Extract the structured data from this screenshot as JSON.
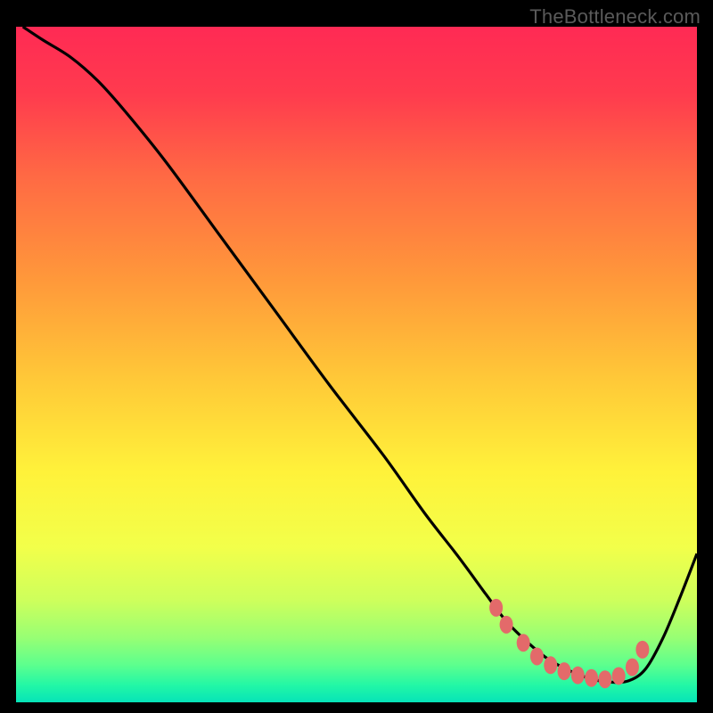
{
  "watermark": "TheBottleneck.com",
  "chart_data": {
    "type": "line",
    "title": "",
    "xlabel": "",
    "ylabel": "",
    "xlim": [
      0,
      100
    ],
    "ylim": [
      0,
      100
    ],
    "gradient_stops": [
      {
        "offset": 0.0,
        "color": "#ff2a54"
      },
      {
        "offset": 0.1,
        "color": "#ff3b4e"
      },
      {
        "offset": 0.22,
        "color": "#ff6944"
      },
      {
        "offset": 0.38,
        "color": "#ff9a3a"
      },
      {
        "offset": 0.52,
        "color": "#ffc838"
      },
      {
        "offset": 0.66,
        "color": "#fff23a"
      },
      {
        "offset": 0.77,
        "color": "#f2ff4a"
      },
      {
        "offset": 0.85,
        "color": "#cdff5c"
      },
      {
        "offset": 0.905,
        "color": "#97ff74"
      },
      {
        "offset": 0.945,
        "color": "#5cff8e"
      },
      {
        "offset": 0.975,
        "color": "#22f7a6"
      },
      {
        "offset": 1.0,
        "color": "#06e3b8"
      }
    ],
    "series": [
      {
        "name": "bottleneck-curve",
        "x": [
          1,
          4,
          8,
          12,
          16,
          22,
          30,
          38,
          46,
          54,
          60,
          65,
          69,
          72,
          75,
          78,
          81,
          84,
          87,
          90,
          92.5,
          95,
          97.5,
          100
        ],
        "y": [
          100,
          98,
          95.5,
          92,
          87.5,
          80,
          69,
          58,
          47,
          36.5,
          28,
          21.5,
          16,
          12,
          9,
          6.5,
          4.8,
          3.6,
          3.0,
          3.2,
          5.0,
          9.5,
          15.5,
          22
        ]
      }
    ],
    "markers": {
      "name": "optimal-range-markers",
      "color": "#e36a6a",
      "points": [
        {
          "x": 70.5,
          "y": 14.0
        },
        {
          "x": 72.0,
          "y": 11.5
        },
        {
          "x": 74.5,
          "y": 8.8
        },
        {
          "x": 76.5,
          "y": 6.8
        },
        {
          "x": 78.5,
          "y": 5.5
        },
        {
          "x": 80.5,
          "y": 4.6
        },
        {
          "x": 82.5,
          "y": 4.0
        },
        {
          "x": 84.5,
          "y": 3.6
        },
        {
          "x": 86.5,
          "y": 3.4
        },
        {
          "x": 88.5,
          "y": 3.9
        },
        {
          "x": 90.5,
          "y": 5.2
        },
        {
          "x": 92.0,
          "y": 7.8
        }
      ]
    }
  }
}
